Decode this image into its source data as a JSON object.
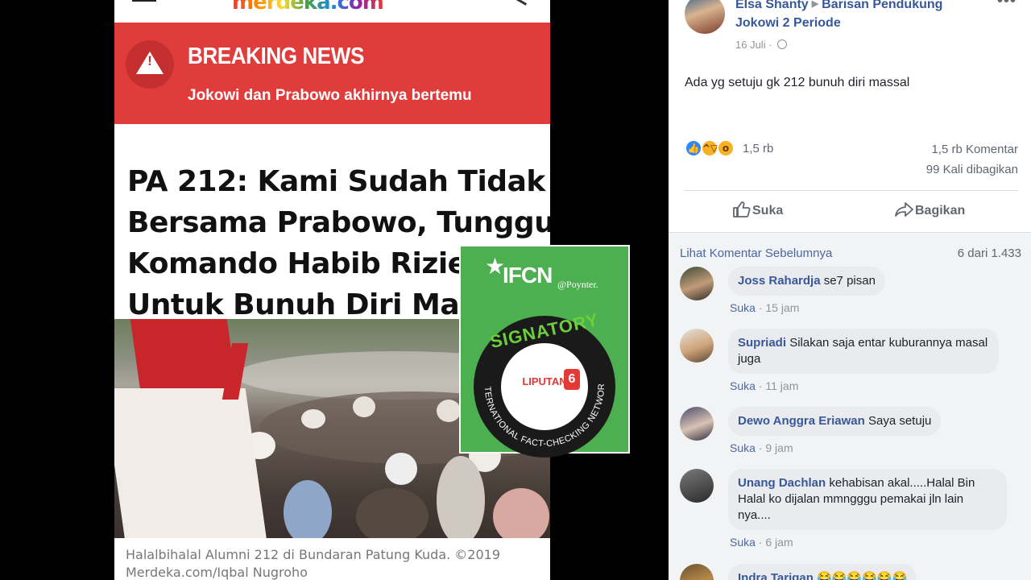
{
  "article": {
    "site_logo": "merdeka.com",
    "breaking_title": "BREAKING NEWS",
    "breaking_subtitle": "Jokowi dan Prabowo akhirnya bertemu",
    "headline_lines": [
      "PA 212: Kami Sudah Tidak",
      "Bersama Prabowo, Tunggu",
      "Komando Habib Rizieq",
      "Untuk Bunuh Diri Massal"
    ],
    "caption_lines": [
      "Halalbihalal Alumni 212 di Bundaran Patung Kuda. ©2019",
      "Merdeka.com/Iqbal Nugroho"
    ]
  },
  "badge": {
    "org": "IFCN",
    "poynter": "@Poynter.",
    "ring_top": "SIGNATORY",
    "ring_bottom": "INTERNATIONAL FACT-CHECKING NETWORK",
    "member": "LIPUTAN",
    "member_number": "6"
  },
  "post": {
    "author": "Elsa Shanty",
    "group_line1": "Barisan Pendukung",
    "group_line2": "Jokowi 2 Periode",
    "date": "16 Juli",
    "more": "•••",
    "text": "Ada yg setuju gk 212 bunuh diri massal",
    "reaction_count": "1,5 rb",
    "comment_count": "1,5 rb Komentar",
    "share_count": "99 Kali dibagikan",
    "like_label": "Suka",
    "share_label": "Bagikan",
    "prev_comments": "Lihat Komentar Sebelumnya",
    "page_count": "6 dari 1.433"
  },
  "comments": [
    {
      "name": "Joss Rahardja",
      "text": "se7 pisan",
      "like": "Suka",
      "time": "15 jam"
    },
    {
      "name": "Supriadi",
      "text": "Silakan saja entar kuburannya masal juga",
      "like": "Suka",
      "time": "11 jam"
    },
    {
      "name": "Dewo Anggra Eriawan",
      "text": "Saya setuju",
      "like": "Suka",
      "time": "9 jam"
    },
    {
      "name": "Unang Dachlan",
      "text": "kehabisan akal.....Halal Bin Halal ko dijalan mmngggu pemakai jln lain nya....",
      "like": "Suka",
      "time": "6 jam"
    },
    {
      "name": "Indra Tarigan",
      "text": "",
      "emojis": "😂😂😂😂😂😂",
      "like": "",
      "time": ""
    }
  ],
  "colors": {
    "breaking_red": "#e03c3c",
    "fb_blue": "#365899",
    "ifcn_green": "#4caf50"
  }
}
